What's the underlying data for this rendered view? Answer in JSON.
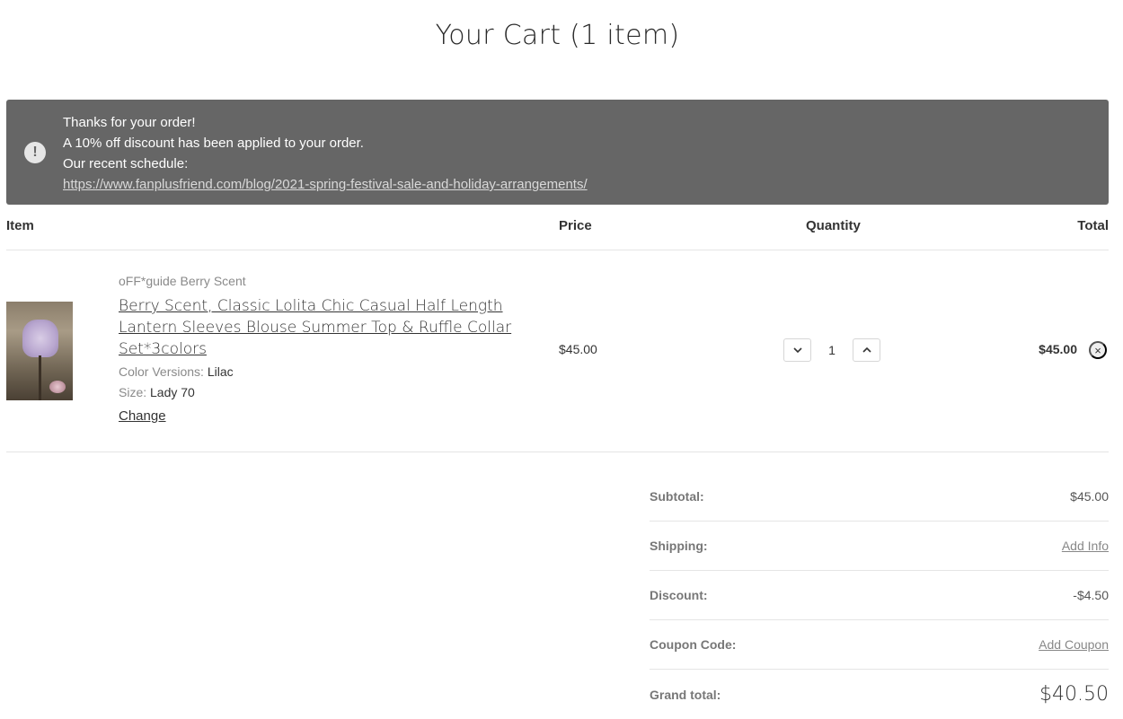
{
  "page": {
    "title": "Your Cart (1 item)"
  },
  "alert": {
    "line1": "Thanks for your order!",
    "line2": "A 10% off discount has been applied to your order.",
    "line3": "Our recent schedule:",
    "link": "https://www.fanplusfriend.com/blog/2021-spring-festival-sale-and-holiday-arrangements/",
    "icon": "!"
  },
  "table": {
    "headers": {
      "item": "Item",
      "price": "Price",
      "quantity": "Quantity",
      "total": "Total"
    }
  },
  "cart_item": {
    "vendor": "oFF*guide Berry Scent",
    "title": "Berry Scent, Classic Lolita Chic Casual Half Length Lantern Sleeves Blouse Summer Top & Ruffle Collar Set*3colors",
    "options": [
      {
        "label": "Color Versions:",
        "value": "Lilac"
      },
      {
        "label": "Size:",
        "value": "Lady 70"
      }
    ],
    "change_label": "Change",
    "price": "$45.00",
    "quantity": "1",
    "line_total": "$45.00",
    "remove_icon": "×",
    "decrease_icon": "chevron-down-icon",
    "increase_icon": "chevron-up-icon"
  },
  "summary": {
    "subtotal_label": "Subtotal:",
    "subtotal_value": "$45.00",
    "shipping_label": "Shipping:",
    "shipping_value": "Add Info",
    "discount_label": "Discount:",
    "discount_value": "-$4.50",
    "coupon_label": "Coupon Code:",
    "coupon_value": "Add Coupon",
    "grand_label": "Grand total:",
    "grand_value": "$40.50"
  },
  "colors": {
    "alert_bg": "#666666",
    "text": "#333333",
    "muted": "#8a8a8a",
    "divider": "#e5e5e5"
  }
}
